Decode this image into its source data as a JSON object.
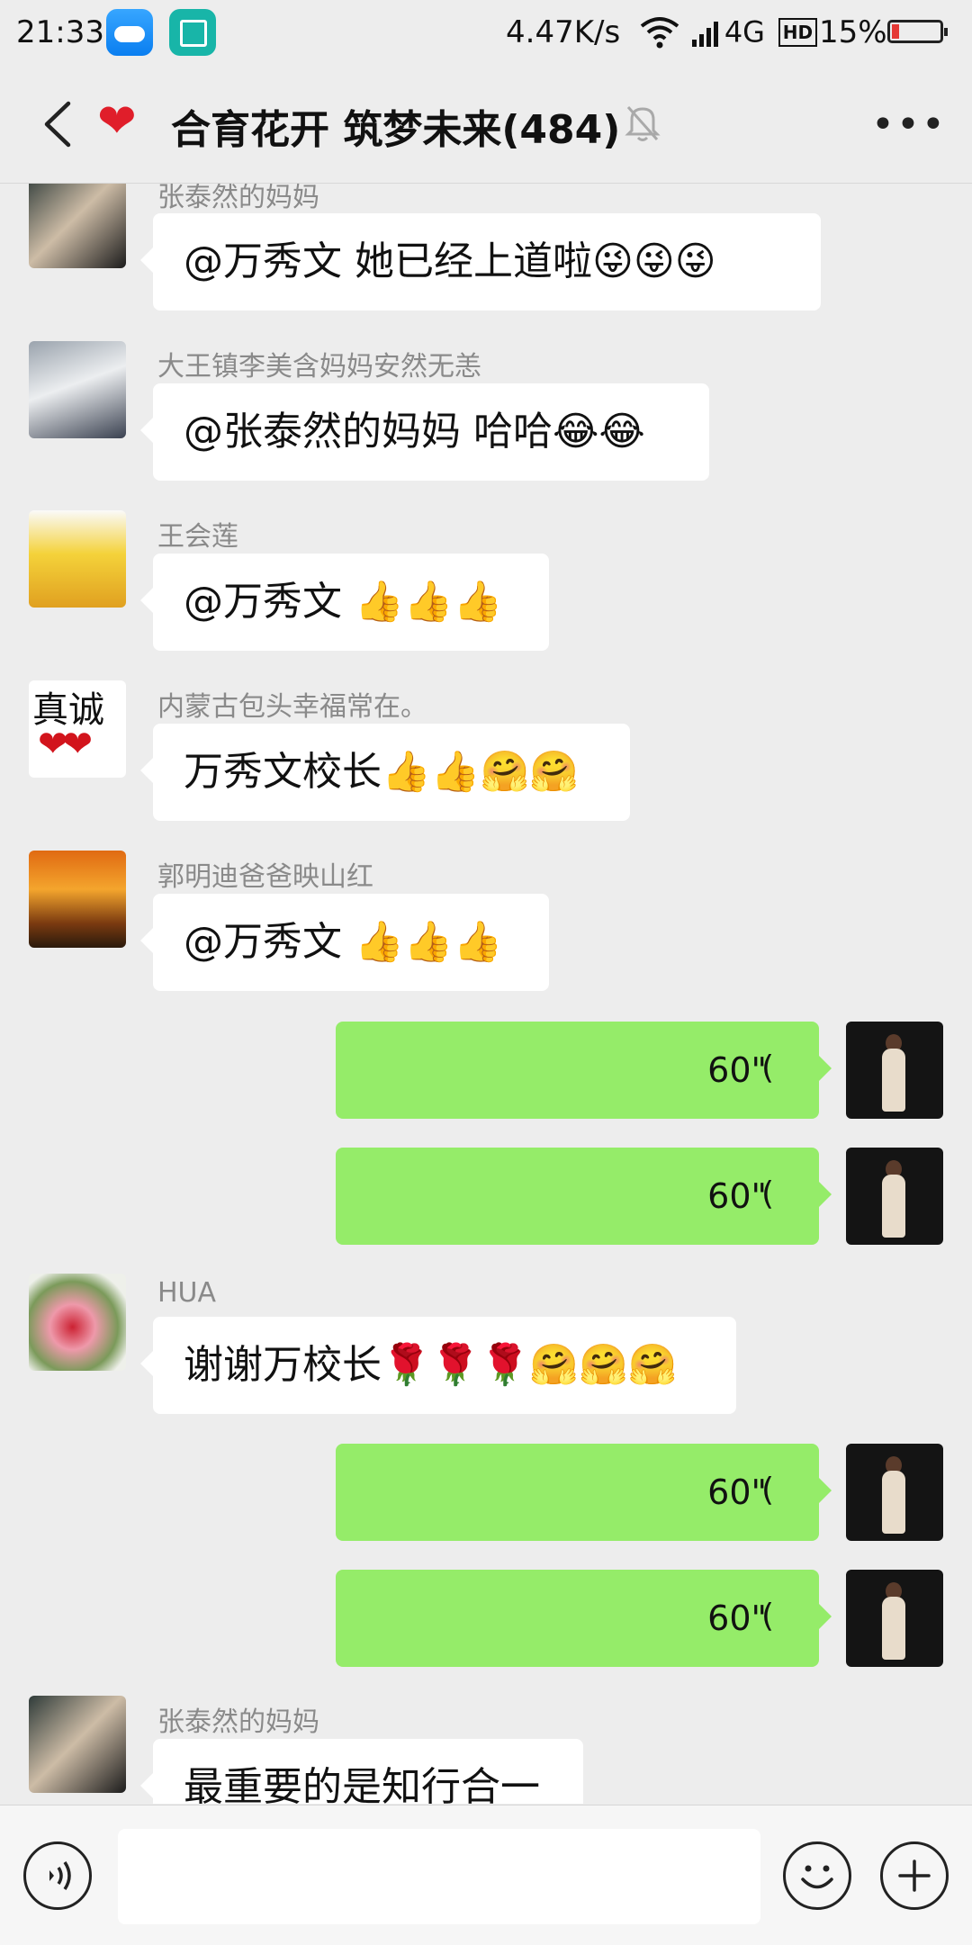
{
  "status_bar": {
    "time": "21:33",
    "speed": "4.47K/s",
    "network": "4G",
    "battery": "15%",
    "icons": [
      "weather-icon",
      "scan-icon",
      "wifi-icon",
      "signal-icon",
      "hd-icon",
      "battery-icon"
    ]
  },
  "header": {
    "title": "合育花开 筑梦未来(484)",
    "icons": [
      "back-icon",
      "heart-icon",
      "mute-icon",
      "more-icon"
    ]
  },
  "messages": [
    {
      "sender": "张泰然的妈妈",
      "text": "@万秀文  她已经上道啦😜😜😜"
    },
    {
      "sender": "大王镇李美含妈妈安然无恙",
      "text": "@张泰然的妈妈  哈哈😂😂"
    },
    {
      "sender": "王会莲",
      "text": "@万秀文  👍👍👍"
    },
    {
      "sender": "内蒙古包头幸福常在。",
      "text": "万秀文校长👍👍🤗🤗"
    },
    {
      "sender": "郭明迪爸爸映山红",
      "text": "@万秀文  👍👍👍"
    },
    {
      "self_voice": "60\""
    },
    {
      "self_voice": "60\""
    },
    {
      "sender": "HUA",
      "text": "谢谢万校长🌹🌹🌹🤗🤗🤗"
    },
    {
      "self_voice": "60\""
    },
    {
      "self_voice": "60\""
    },
    {
      "sender": "张泰然的妈妈",
      "text": "最重要的是知行合一"
    }
  ],
  "colors": {
    "background": "#ededed",
    "self_bubble": "#95ec69",
    "other_bubble": "#ffffff"
  },
  "input_bar": {
    "icons": [
      "voice-toggle-icon",
      "emoji-icon",
      "plus-icon"
    ]
  }
}
